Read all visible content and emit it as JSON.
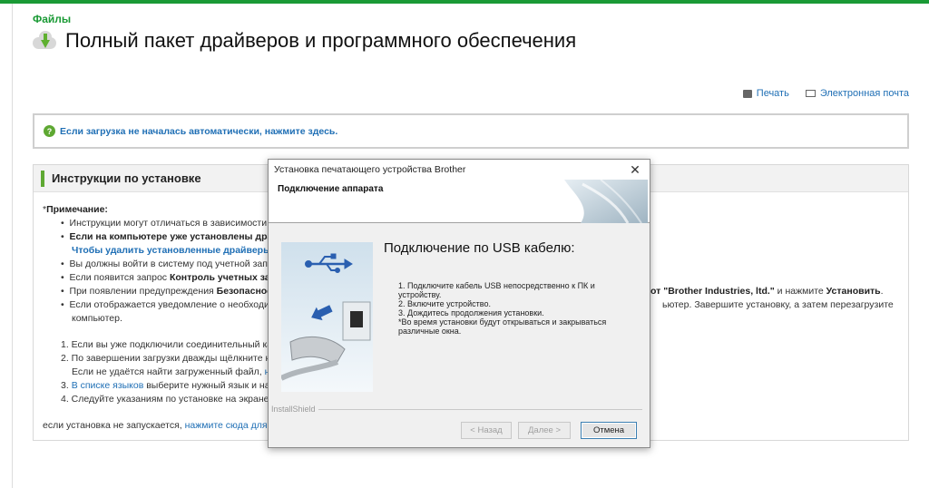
{
  "breadcrumb": "Файлы",
  "page_title": "Полный пакет драйверов и программного обеспечения",
  "actions": {
    "print": "Печать",
    "email": "Электронная почта"
  },
  "notice": "Если загрузка не началась автоматически, нажмите здесь.",
  "instructions": {
    "heading": "Инструкции по установке",
    "note_star": "*",
    "note_label": "Примечание:",
    "bullets": [
      "Инструкции могут отличаться в зависимости о",
      "Если на компьютере уже установлены драй",
      "Чтобы удалить установленные драйверы, ",
      "Вы должны войти в систему под учетной запис",
      "Если появится запрос ",
      "Контроль учетных запи",
      "При появлении предупреждения ",
      "Безопасност",
      "от \"Brother Industries, ltd.\"",
      " и нажмите ",
      "Установить",
      ".",
      "Если отображается уведомление о необходим",
      "ьютер. Завершите установку, а затем перезагрузите",
      "компьютер."
    ],
    "steps": [
      "1. Если вы уже подключили соединительный кабе",
      "2. По завершении загрузки дважды щёлкните на",
      "Если не удаётся найти загруженный файл, ",
      "на",
      "3. ",
      "В списке языков",
      " выберите нужный язык и наж",
      "4. Следуйте указаниям по установке на экране."
    ],
    "footer_text": "если установка не запускается, ",
    "footer_link": "нажмите сюда для пр"
  },
  "dialog": {
    "title": "Установка печатающего устройства Brother",
    "close": "✕",
    "header": "Подключение аппарата",
    "usb_title": "Подключение по USB кабелю:",
    "steps": "1. Подключите кабель USB непосредственно к ПК и\n    устройству.\n2. Включите устройство.\n3. Дождитесь продолжения установки.\n *Во время установки будут открываться и закрываться\n  различные окна.",
    "installshield": "InstallShield",
    "btn_back": "< Назад",
    "btn_next": "Далее >",
    "btn_cancel": "Отмена"
  },
  "colors": {
    "brand_green": "#1a9a35",
    "link_blue": "#1f6fb5",
    "usb_blue": "#2a5fb0"
  }
}
